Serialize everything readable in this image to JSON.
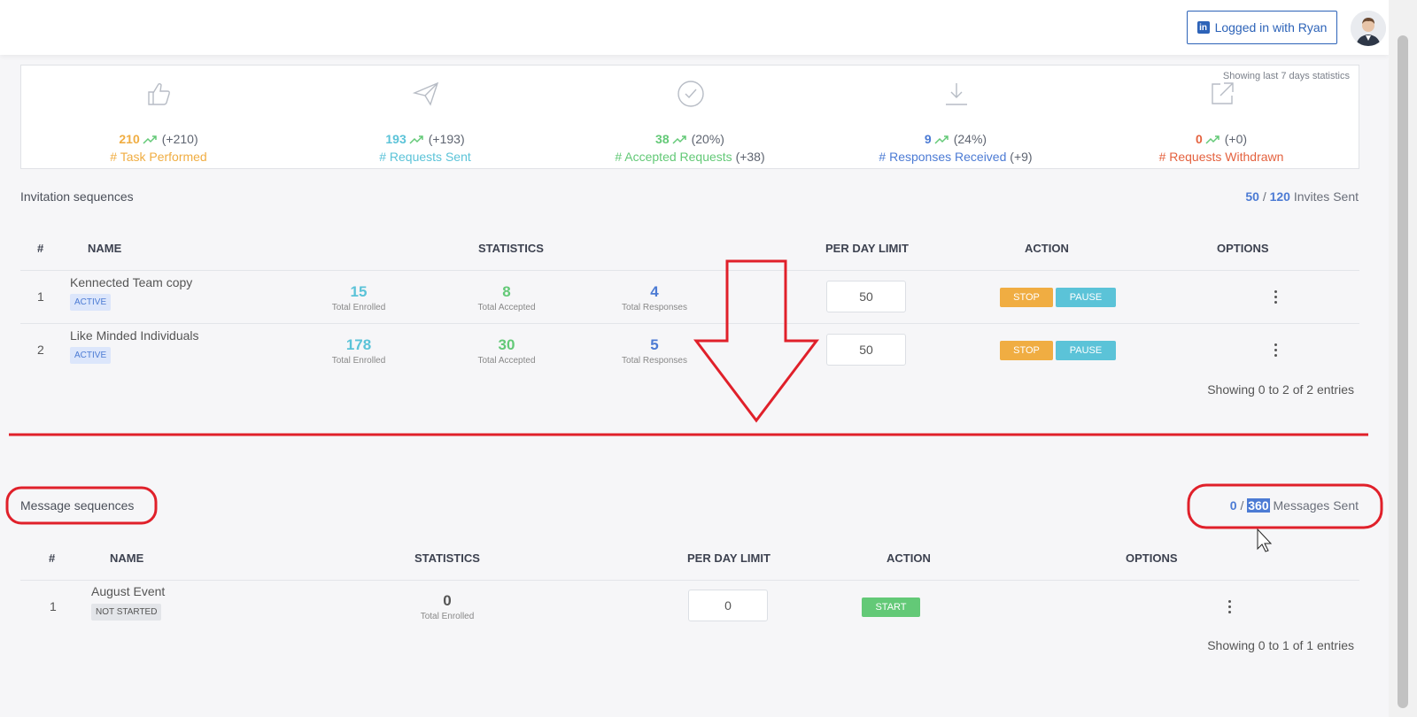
{
  "header": {
    "linkedin_label": "Logged in with Ryan"
  },
  "stats": {
    "note": "Showing last 7 days statistics",
    "items": [
      {
        "icon": "thumbs-up-icon",
        "value": "210",
        "delta": "(+210)",
        "label": "# Task Performed",
        "extra": "",
        "color": "#f0ad42"
      },
      {
        "icon": "paper-plane-icon",
        "value": "193",
        "delta": "(+193)",
        "label": "# Requests Sent",
        "extra": "",
        "color": "#5bc3d8"
      },
      {
        "icon": "check-circle-icon",
        "value": "38",
        "delta": "(20%)",
        "label": "# Accepted Requests",
        "extra": "(+38)",
        "color": "#63c977"
      },
      {
        "icon": "download-icon",
        "value": "9",
        "delta": "(24%)",
        "label": "# Responses Received",
        "extra": "(+9)",
        "color": "#4c7bd4"
      },
      {
        "icon": "external-link-icon",
        "value": "0",
        "delta": "(+0)",
        "label": "# Requests Withdrawn",
        "extra": "",
        "color": "#e4623f"
      }
    ]
  },
  "invitations": {
    "title": "Invitation sequences",
    "counter": {
      "current": "50",
      "separator": "/",
      "total": "120",
      "suffix": "Invites Sent"
    },
    "columns": {
      "num": "#",
      "name": "NAME",
      "statistics": "STATISTICS",
      "limit": "PER DAY LIMIT",
      "action": "ACTION",
      "options": "OPTIONS"
    },
    "rows": [
      {
        "num": "1",
        "name": "Kennected Team copy",
        "status": "ACTIVE",
        "enrolled": "15",
        "enrolled_label": "Total Enrolled",
        "accepted": "8",
        "accepted_label": "Total Accepted",
        "responses": "4",
        "responses_label": "Total Responses",
        "limit": "50",
        "stop": "STOP",
        "pause": "PAUSE"
      },
      {
        "num": "2",
        "name": "Like Minded Individuals",
        "status": "ACTIVE",
        "enrolled": "178",
        "enrolled_label": "Total Enrolled",
        "accepted": "30",
        "accepted_label": "Total Accepted",
        "responses": "5",
        "responses_label": "Total Responses",
        "limit": "50",
        "stop": "STOP",
        "pause": "PAUSE"
      }
    ],
    "entries": "Showing 0 to 2 of 2 entries"
  },
  "messages": {
    "title": "Message sequences",
    "counter": {
      "current": "0",
      "separator": "/",
      "total": "360",
      "suffix": "Messages Sent"
    },
    "columns": {
      "num": "#",
      "name": "NAME",
      "statistics": "STATISTICS",
      "limit": "PER DAY LIMIT",
      "action": "ACTION",
      "options": "OPTIONS"
    },
    "rows": [
      {
        "num": "1",
        "name": "August Event",
        "status": "NOT STARTED",
        "enrolled": "0",
        "enrolled_label": "Total Enrolled",
        "limit": "0",
        "start": "START"
      }
    ],
    "entries": "Showing 0 to 1 of 1 entries"
  },
  "colors": {
    "accent_blue": "#4c7bd4",
    "linkedin": "#2d63b8",
    "annotation_red": "#e0202a"
  }
}
